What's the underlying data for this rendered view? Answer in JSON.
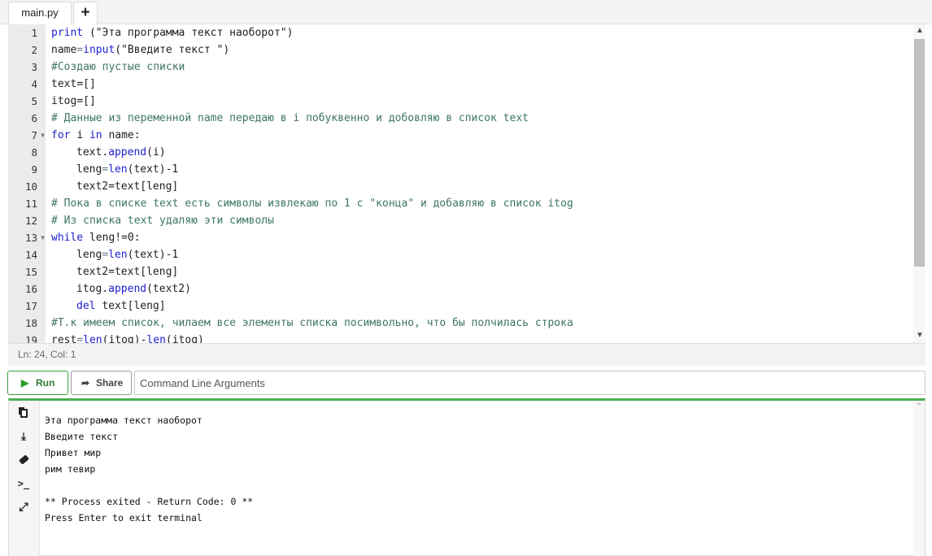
{
  "tabs": {
    "active_file": "main.py",
    "add_label": "+"
  },
  "editor": {
    "lines": [
      {
        "n": "1",
        "text": "print (\"Эта программа текст наоборот\")",
        "style": "code"
      },
      {
        "n": "2",
        "text": "name=input(\"Введите текст \")",
        "style": "code"
      },
      {
        "n": "3",
        "text": "#Создаю пустые списки",
        "style": "comment"
      },
      {
        "n": "4",
        "text": "text=[]",
        "style": "code"
      },
      {
        "n": "5",
        "text": "itog=[]",
        "style": "code"
      },
      {
        "n": "6",
        "text": "# Данные из переменной name передаю в i побуквенно и добовляю в список text",
        "style": "comment"
      },
      {
        "n": "7",
        "text": "for i in name:",
        "style": "code",
        "fold": true
      },
      {
        "n": "8",
        "text": "text.append(i)",
        "style": "code",
        "indent": 1
      },
      {
        "n": "9",
        "text": "leng=len(text)-1",
        "style": "code",
        "indent": 1
      },
      {
        "n": "10",
        "text": "text2=text[leng]",
        "style": "code",
        "indent": 1
      },
      {
        "n": "11",
        "text": "# Пока в списке text есть символы извлекаю по 1 с \"конца\" и добавляю в список itog",
        "style": "comment"
      },
      {
        "n": "12",
        "text": "# Из списка text удаляю эти символы",
        "style": "comment"
      },
      {
        "n": "13",
        "text": "while leng!=0:",
        "style": "code",
        "fold": true
      },
      {
        "n": "14",
        "text": "leng=len(text)-1",
        "style": "code",
        "indent": 1
      },
      {
        "n": "15",
        "text": "text2=text[leng]",
        "style": "code",
        "indent": 1
      },
      {
        "n": "16",
        "text": "itog.append(text2)",
        "style": "code",
        "indent": 1
      },
      {
        "n": "17",
        "text": "del text[leng]",
        "style": "code",
        "indent": 1
      },
      {
        "n": "18",
        "text": "#Т.к имеем список, чилаем все элементы списка посимвольно, что бы полчилась строка",
        "style": "comment"
      },
      {
        "n": "19",
        "text": "rest=len(itog)-len(itog)",
        "style": "code"
      }
    ],
    "colors": {
      "keyword": "#2020d0",
      "comment": "#3d7565",
      "text": "#1f1f1f"
    }
  },
  "status": {
    "cursor": "Ln: 24,  Col: 1"
  },
  "toolbar": {
    "run_label": "Run",
    "share_label": "Share",
    "args_placeholder": "Command Line Arguments"
  },
  "terminal": {
    "accent": "#4caf50",
    "lines": [
      "Эта программа текст наоборот",
      "Введите текст",
      "Привет мир",
      "рим тевир",
      "",
      "** Process exited - Return Code: 0 **",
      "Press Enter to exit terminal"
    ],
    "tools": [
      "copy-icon",
      "download-icon",
      "eraser-icon",
      "terminal-icon",
      "expand-icon"
    ]
  }
}
